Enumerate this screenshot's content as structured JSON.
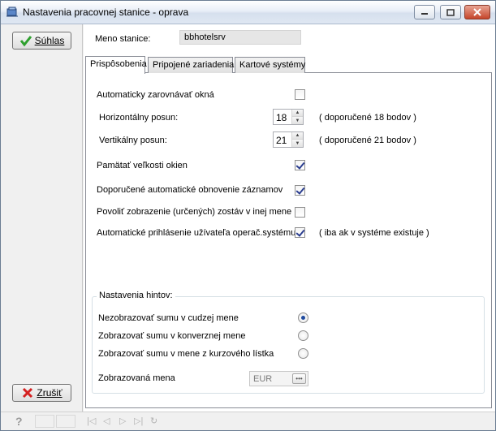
{
  "window": {
    "title": "Nastavenia pracovnej stanice - oprava"
  },
  "left": {
    "ok_label": "Súhlas",
    "ok_mnemonic": "S",
    "cancel_label": "Zrušiť",
    "cancel_mnemonic": "Z"
  },
  "station": {
    "label": "Meno stanice:",
    "value": "bbhotelsrv"
  },
  "tabs": [
    {
      "label": "Prispôsobenia",
      "active": true
    },
    {
      "label": "Pripojené zariadenia",
      "active": false
    },
    {
      "label": "Kartové systémy",
      "active": false
    }
  ],
  "settings": {
    "auto_align": {
      "label": "Automaticky zarovnávať okná",
      "checked": false
    },
    "h_offset": {
      "label": "Horizontálny posun:",
      "value": "18",
      "hint": "( doporučené 18 bodov )"
    },
    "v_offset": {
      "label": "Vertikálny posun:",
      "value": "21",
      "hint": "( doporučené 21 bodov )"
    },
    "remember_size": {
      "label": "Pamätať veľkosti okien",
      "checked": true
    },
    "auto_refresh": {
      "label": "Doporučené automatické obnovenie záznamov",
      "checked": true
    },
    "other_currency": {
      "label": "Povoliť zobrazenie (určených) zostáv v inej mene",
      "checked": false
    },
    "auto_login": {
      "label": "Automatické prihlásenie užívateľa operač.systému",
      "checked": true,
      "hint": "( iba ak v systéme existuje )"
    }
  },
  "hints_group": {
    "title": "Nastavenia hintov:",
    "options": [
      {
        "label": "Nezobrazovať sumu v cudzej mene",
        "selected": true
      },
      {
        "label": "Zobrazovať sumu v konverznej mene",
        "selected": false
      },
      {
        "label": "Zobrazovať sumu v mene z kurzového lístka",
        "selected": false
      }
    ],
    "currency_label": "Zobrazovaná mena",
    "currency_value": "EUR"
  },
  "statusbar": {
    "help_glyph": "?",
    "nav_first": "|◁",
    "nav_prev": "◁",
    "nav_next": "▷",
    "nav_last": "▷|",
    "nav_refresh": "↻"
  },
  "colors": {
    "accent_blue": "#1f4a9e",
    "ok_check_green": "#2ea02e",
    "cancel_x_red": "#d42020"
  }
}
